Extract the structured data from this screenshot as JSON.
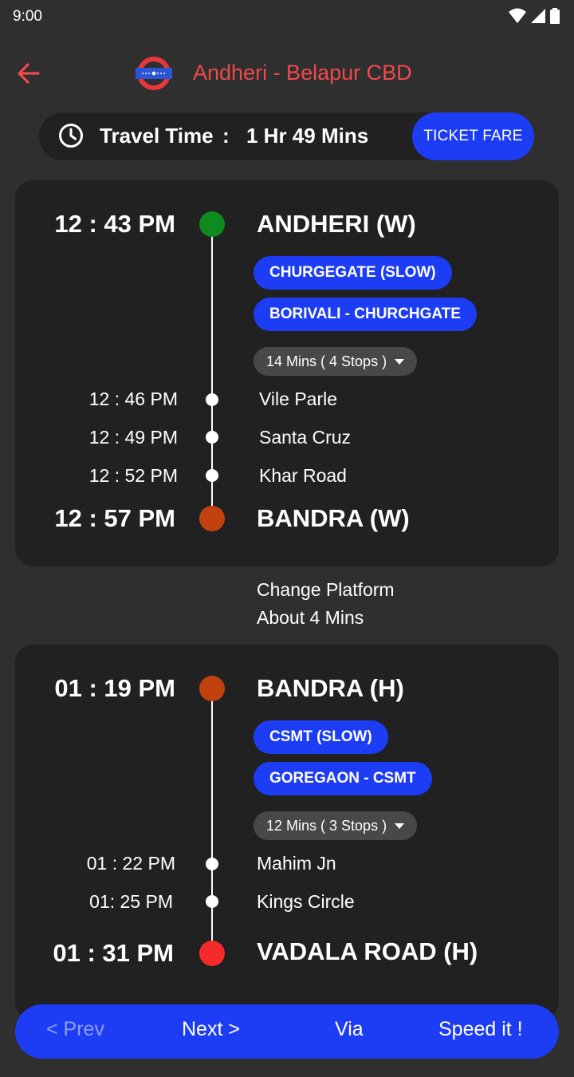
{
  "status_bar": {
    "time": "9:00"
  },
  "header": {
    "title": "Andheri - Belapur CBD"
  },
  "travel": {
    "label": "Travel Time",
    "separator": ":",
    "value": "1 Hr 49 Mins",
    "fare_button": "TICKET FARE"
  },
  "legs": [
    {
      "start_time": "12 : 43 PM",
      "start_station": "ANDHERI (W)",
      "start_color": "#0f8a1e",
      "trains": [
        "CHURGEGATE  (SLOW)",
        "BORIVALI - CHURCHGATE"
      ],
      "stops_summary": "14 Mins ( 4 Stops )",
      "stops": [
        {
          "time": "12 : 46 PM",
          "name": "Vile Parle"
        },
        {
          "time": "12 : 49 PM",
          "name": "Santa Cruz"
        },
        {
          "time": "12 : 52 PM",
          "name": "Khar Road"
        }
      ],
      "end_time": "12 : 57 PM",
      "end_station": "BANDRA (W)",
      "end_color": "#c1420f"
    },
    {
      "start_time": "01 : 19 PM",
      "start_station": "BANDRA (H)",
      "start_color": "#c1420f",
      "trains": [
        "CSMT (SLOW)",
        "GOREGAON - CSMT"
      ],
      "stops_summary": "12 Mins ( 3 Stops )",
      "stops": [
        {
          "time": "01 : 22 PM",
          "name": "Mahim Jn"
        },
        {
          "time": "01: 25 PM",
          "name": "Kings Circle"
        }
      ],
      "end_time": "01 : 31 PM",
      "end_station": "VADALA ROAD (H)",
      "end_color": "#f52a2a"
    }
  ],
  "transfer": {
    "line1": "Change Platform",
    "line2": "About 4 Mins"
  },
  "bottom_nav": {
    "prev": "< Prev",
    "next": "Next >",
    "via": "Via",
    "speed": "Speed it !"
  },
  "colors": {
    "accent": "#1d3df5",
    "title": "#f0494c",
    "background": "#2f2f30",
    "card": "#212122"
  }
}
